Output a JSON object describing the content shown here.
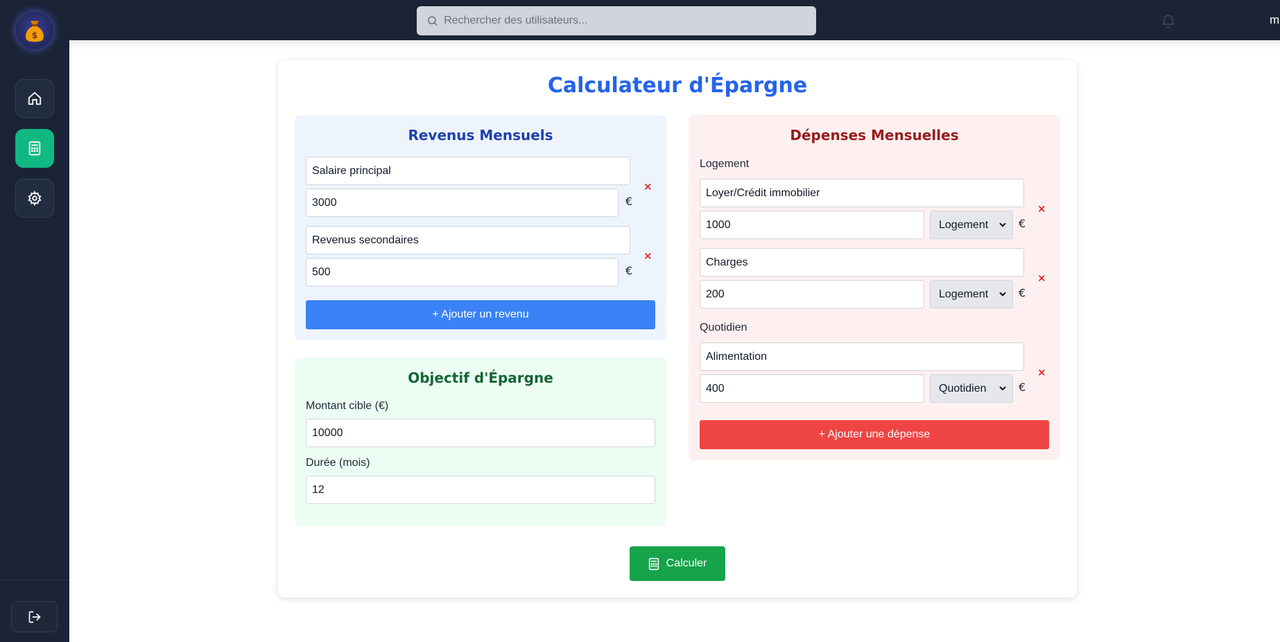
{
  "search": {
    "placeholder": "Rechercher des utilisateurs..."
  },
  "user": {
    "name": "manar"
  },
  "page": {
    "title": "Calculateur d'Épargne"
  },
  "income": {
    "title": "Revenus Mensuels",
    "items": [
      {
        "name": "Salaire principal",
        "amount": "3000"
      },
      {
        "name": "Revenus secondaires",
        "amount": "500"
      }
    ],
    "currency": "€",
    "remove_symbol": "×",
    "add_label": "+ Ajouter un revenu"
  },
  "goal": {
    "title": "Objectif d'Épargne",
    "target_label": "Montant cible (€)",
    "target_value": "10000",
    "duration_label": "Durée (mois)",
    "duration_value": "12"
  },
  "expenses": {
    "title": "Dépenses Mensuelles",
    "groups": [
      {
        "category": "Logement",
        "items": [
          {
            "name": "Loyer/Crédit immobilier",
            "amount": "1000",
            "category": "Logement"
          },
          {
            "name": "Charges",
            "amount": "200",
            "category": "Logement"
          }
        ]
      },
      {
        "category": "Quotidien",
        "items": [
          {
            "name": "Alimentation",
            "amount": "400",
            "category": "Quotidien"
          }
        ]
      }
    ],
    "currency": "€",
    "remove_symbol": "×",
    "add_label": "+ Ajouter une dépense"
  },
  "actions": {
    "calculate_label": "Calculer"
  },
  "colors": {
    "accent_blue": "#2563eb",
    "active_nav": "#10b981",
    "income_button": "#3b82f6",
    "expense_button": "#ef4444",
    "calculate_button": "#16a34a"
  }
}
